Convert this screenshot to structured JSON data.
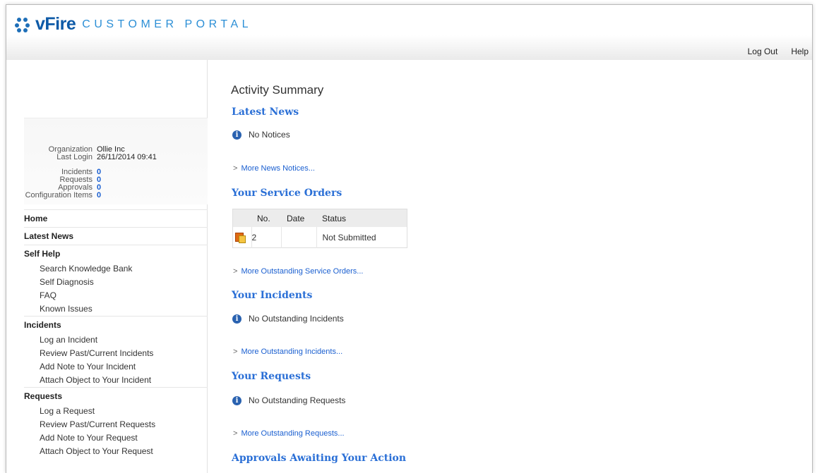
{
  "header": {
    "logo_main": "vFire",
    "logo_sub": "CUSTOMER PORTAL",
    "links": {
      "logout": "Log Out",
      "help": "Help"
    }
  },
  "sidebar": {
    "info": {
      "organization_label": "Organization",
      "organization_value": "Ollie Inc",
      "last_login_label": "Last Login",
      "last_login_value": "26/11/2014 09:41",
      "counts": [
        {
          "label": "Incidents",
          "value": "0"
        },
        {
          "label": "Requests",
          "value": "0"
        },
        {
          "label": "Approvals",
          "value": "0"
        },
        {
          "label": "Configuration Items",
          "value": "0"
        }
      ]
    },
    "nav": {
      "home": "Home",
      "latest_news": "Latest News",
      "self_help": {
        "label": "Self Help",
        "items": [
          "Search Knowledge Bank",
          "Self Diagnosis",
          "FAQ",
          "Known Issues"
        ]
      },
      "incidents": {
        "label": "Incidents",
        "items": [
          "Log an Incident",
          "Review Past/Current Incidents",
          "Add Note to Your Incident",
          "Attach Object to Your Incident"
        ]
      },
      "requests": {
        "label": "Requests",
        "items": [
          "Log a Request",
          "Review Past/Current Requests",
          "Add Note to Your Request",
          "Attach Object to Your Request"
        ]
      }
    }
  },
  "main": {
    "title": "Activity Summary",
    "latest_news": {
      "title": "Latest News",
      "notice": "No Notices",
      "more": "More News Notices..."
    },
    "service_orders": {
      "title": "Your Service Orders",
      "columns": [
        "No.",
        "Date",
        "Status"
      ],
      "rows": [
        {
          "no": "2",
          "date": "",
          "status": "Not Submitted",
          "icon": "service-order-icon"
        }
      ],
      "more": "More Outstanding Service Orders..."
    },
    "incidents": {
      "title": "Your Incidents",
      "notice": "No Outstanding Incidents",
      "more": "More Outstanding Incidents..."
    },
    "requests": {
      "title": "Your Requests",
      "notice": "No Outstanding Requests",
      "more": "More Outstanding Requests..."
    },
    "approvals": {
      "title": "Approvals Awaiting Your Action"
    }
  },
  "colors": {
    "accent_blue": "#2a6fd6",
    "link_blue": "#1a5fd0",
    "logo_blue": "#0d5aa7"
  }
}
